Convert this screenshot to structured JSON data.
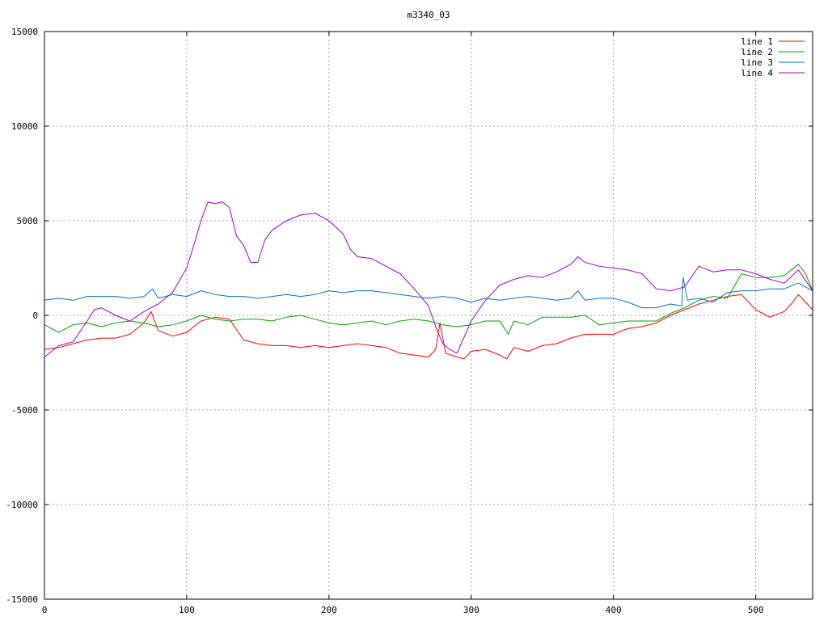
{
  "chart_data": {
    "type": "line",
    "title": "m3340_03",
    "xlabel": "",
    "ylabel": "",
    "xlim": [
      0,
      540
    ],
    "ylim": [
      -15000,
      15000
    ],
    "x_ticks": [
      0,
      100,
      200,
      300,
      400,
      500
    ],
    "y_ticks": [
      -15000,
      -10000,
      -5000,
      0,
      5000,
      10000,
      15000
    ],
    "grid": true,
    "legend_position": "top-right",
    "series": [
      {
        "name": "line 1",
        "color": "#ff0000",
        "x": [
          0,
          10,
          20,
          30,
          40,
          50,
          60,
          70,
          75,
          80,
          90,
          100,
          110,
          120,
          130,
          140,
          150,
          160,
          170,
          180,
          190,
          200,
          210,
          220,
          230,
          240,
          250,
          260,
          270,
          275,
          278,
          282,
          290,
          295,
          300,
          310,
          320,
          325,
          330,
          340,
          350,
          360,
          370,
          380,
          390,
          400,
          410,
          420,
          430,
          440,
          450,
          460,
          470,
          480,
          490,
          500,
          510,
          520,
          525,
          530,
          535,
          540
        ],
        "y": [
          -1800,
          -1700,
          -1500,
          -1300,
          -1200,
          -1200,
          -1000,
          -400,
          200,
          -800,
          -1100,
          -900,
          -300,
          -100,
          -200,
          -1300,
          -1500,
          -1600,
          -1600,
          -1700,
          -1600,
          -1700,
          -1600,
          -1500,
          -1600,
          -1700,
          -2000,
          -2100,
          -2200,
          -1800,
          -400,
          -2000,
          -2200,
          -2300,
          -1900,
          -1800,
          -2100,
          -2300,
          -1700,
          -1900,
          -1600,
          -1500,
          -1200,
          -1000,
          -1000,
          -1000,
          -700,
          -600,
          -400,
          0,
          300,
          600,
          800,
          1000,
          1100,
          300,
          -100,
          200,
          600,
          1100,
          700,
          300
        ]
      },
      {
        "name": "line 2",
        "color": "#00a000",
        "x": [
          0,
          10,
          20,
          30,
          40,
          50,
          60,
          70,
          80,
          90,
          100,
          110,
          120,
          130,
          140,
          150,
          160,
          170,
          180,
          190,
          200,
          210,
          220,
          230,
          240,
          250,
          260,
          270,
          280,
          290,
          300,
          310,
          320,
          326,
          330,
          340,
          350,
          360,
          370,
          380,
          390,
          400,
          410,
          420,
          430,
          440,
          450,
          460,
          470,
          480,
          490,
          500,
          510,
          520,
          530,
          535,
          540
        ],
        "y": [
          -500,
          -900,
          -500,
          -400,
          -600,
          -400,
          -300,
          -400,
          -600,
          -500,
          -300,
          0,
          -200,
          -300,
          -200,
          -200,
          -300,
          -100,
          0,
          -200,
          -400,
          -500,
          -400,
          -300,
          -500,
          -300,
          -200,
          -300,
          -500,
          -600,
          -500,
          -300,
          -300,
          -1000,
          -300,
          -500,
          -100,
          -100,
          -100,
          0,
          -500,
          -400,
          -300,
          -300,
          -300,
          100,
          400,
          800,
          1000,
          900,
          2200,
          2000,
          2000,
          2100,
          2700,
          2200,
          1300
        ]
      },
      {
        "name": "line 3",
        "color": "#0070d0",
        "x": [
          0,
          10,
          20,
          30,
          40,
          50,
          60,
          70,
          76,
          80,
          90,
          100,
          110,
          120,
          130,
          140,
          150,
          160,
          170,
          180,
          190,
          200,
          210,
          220,
          230,
          240,
          250,
          260,
          270,
          280,
          290,
          300,
          310,
          320,
          330,
          340,
          350,
          360,
          370,
          375,
          380,
          390,
          400,
          410,
          420,
          430,
          440,
          448,
          449,
          452,
          460,
          470,
          480,
          490,
          500,
          510,
          520,
          530,
          540
        ],
        "y": [
          800,
          900,
          800,
          1000,
          1000,
          1000,
          900,
          1000,
          1400,
          900,
          1100,
          1000,
          1300,
          1100,
          1000,
          1000,
          900,
          1000,
          1100,
          1000,
          1100,
          1300,
          1200,
          1300,
          1300,
          1200,
          1100,
          1000,
          900,
          1000,
          900,
          700,
          900,
          800,
          900,
          1000,
          900,
          800,
          900,
          1300,
          800,
          900,
          900,
          700,
          400,
          400,
          600,
          500,
          2000,
          800,
          900,
          700,
          1200,
          1300,
          1300,
          1400,
          1400,
          1700,
          1300
        ]
      },
      {
        "name": "line 4",
        "color": "#a000d0",
        "x": [
          0,
          10,
          20,
          30,
          35,
          40,
          50,
          60,
          70,
          80,
          90,
          100,
          105,
          110,
          115,
          120,
          125,
          130,
          135,
          140,
          145,
          150,
          155,
          160,
          170,
          180,
          190,
          200,
          210,
          215,
          220,
          230,
          240,
          250,
          260,
          270,
          275,
          280,
          285,
          290,
          300,
          310,
          320,
          330,
          340,
          350,
          360,
          370,
          375,
          380,
          390,
          400,
          410,
          420,
          430,
          440,
          450,
          460,
          470,
          480,
          490,
          500,
          510,
          520,
          530,
          540
        ],
        "y": [
          -2200,
          -1600,
          -1400,
          -300,
          300,
          400,
          0,
          -300,
          200,
          600,
          1200,
          2500,
          3700,
          5000,
          6000,
          5900,
          6000,
          5700,
          4200,
          3700,
          2800,
          2800,
          4000,
          4500,
          5000,
          5300,
          5400,
          5000,
          4300,
          3500,
          3100,
          3000,
          2600,
          2200,
          1400,
          500,
          -600,
          -1500,
          -1800,
          -2000,
          -300,
          800,
          1600,
          1900,
          2100,
          2000,
          2300,
          2700,
          3100,
          2800,
          2600,
          2500,
          2400,
          2200,
          1400,
          1300,
          1500,
          2600,
          2300,
          2400,
          2400,
          2200,
          1900,
          1700,
          2400,
          1300
        ]
      }
    ]
  }
}
